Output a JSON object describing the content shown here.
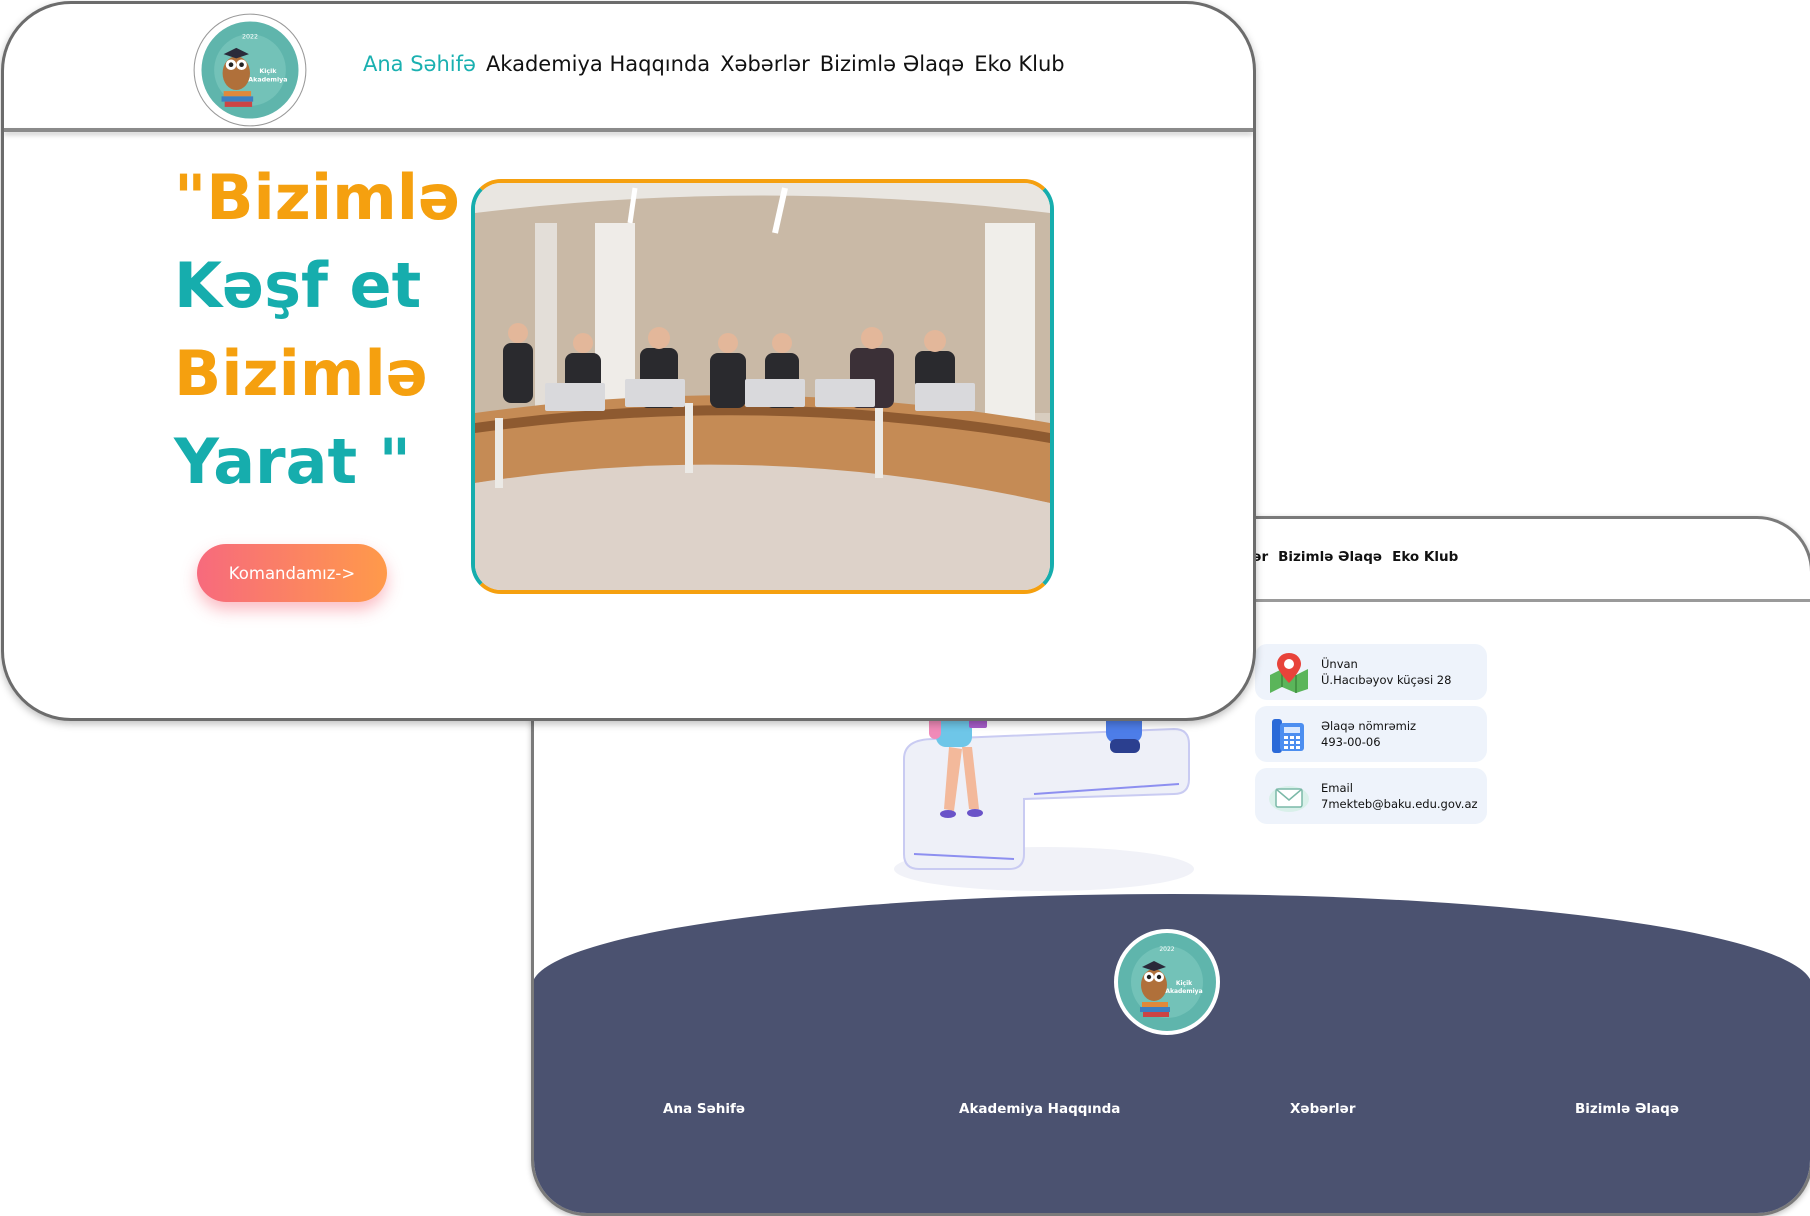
{
  "front": {
    "nav": [
      "Ana Səhifə",
      "Akademiya Haqqında",
      "Xəbərlər",
      "Bizimlə Əlaqə",
      "Eko Klub"
    ],
    "headline": [
      "\"Bizimlə",
      "Kəşf et",
      "Bizimlə",
      "Yarat \""
    ],
    "cta_label": "Komandamız->"
  },
  "logo": {
    "ring_text": "Ə.Haqverdiyev adına 7 nömrəli tam orta məktəb · Məktəb bizim gələcəyimiz təhsil isə gələcəyimizin təminatı",
    "year": "2022",
    "name": [
      "Kiçik",
      "Akademiya"
    ]
  },
  "back": {
    "nav": [
      "rlər",
      "Bizimlə Əlaqə",
      "Eko Klub"
    ],
    "contacts": [
      {
        "title": "Ünvan",
        "value": "Ü.Hacıbəyov küçəsi 28",
        "icon": "map-pin-icon"
      },
      {
        "title": "Əlaqə nömrəmiz",
        "value": "493-00-06",
        "icon": "phone-icon"
      },
      {
        "title": "Email",
        "value": "7mekteb@baku.edu.gov.az",
        "icon": "mail-icon"
      }
    ],
    "footer_nav": [
      "Ana Səhifə",
      "Akademiya Haqqında",
      "Xəbərlər",
      "Bizimlə Əlaqə"
    ]
  },
  "colors": {
    "accent_teal": "#16adad",
    "accent_orange": "#f5a00f",
    "footer_bg": "#4b5270"
  }
}
